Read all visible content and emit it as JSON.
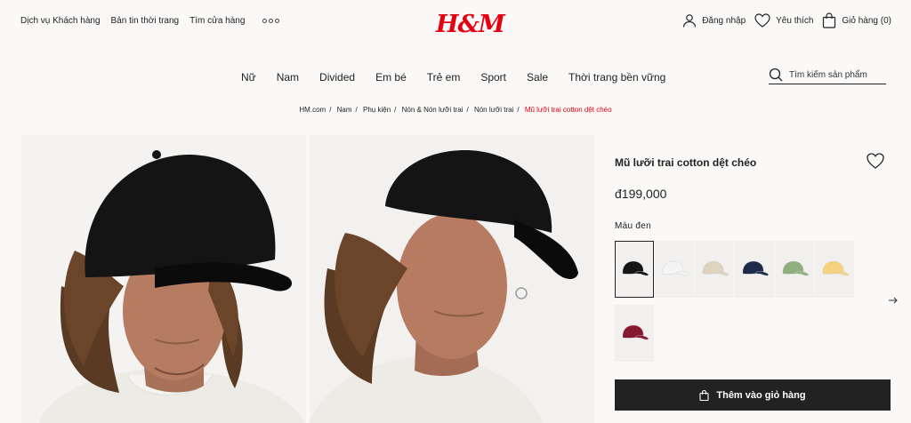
{
  "header": {
    "links": [
      "Dịch vụ Khách hàng",
      "Bản tin thời trang",
      "Tìm cửa hàng"
    ],
    "logo": "H&M",
    "account": {
      "login": "Đăng nhập",
      "favorites": "Yêu thích",
      "cart": "Giỏ hàng (0)"
    }
  },
  "nav": {
    "items": [
      "Nữ",
      "Nam",
      "Divided",
      "Em bé",
      "Trẻ em",
      "Sport",
      "Sale",
      "Thời trang bền vững"
    ],
    "search_placeholder": "Tìm kiếm sản phẩm"
  },
  "breadcrumb": {
    "items": [
      "HM.com",
      "Nam",
      "Phụ kiện",
      "Nón & Nón lưỡi trai",
      "Nón lưỡi trai"
    ],
    "current": "Mũ lưỡi trai cotton dệt chéo"
  },
  "product": {
    "title": "Mũ lưỡi trai cotton dệt chéo",
    "price": "đ199,000",
    "color_label": "Màu đen",
    "swatches": [
      {
        "color": "#151515",
        "selected": true
      },
      {
        "color": "#f4f4f4",
        "selected": false
      },
      {
        "color": "#ddd3bf",
        "selected": false
      },
      {
        "color": "#1e2a4a",
        "selected": false
      },
      {
        "color": "#8fb07e",
        "selected": false
      },
      {
        "color": "#f4d27f",
        "selected": false
      },
      {
        "color": "#8a1730",
        "selected": false
      }
    ],
    "add_to_cart": "Thêm vào giỏ hàng"
  },
  "colors": {
    "brand": "#e50010",
    "button_bg": "#222222"
  }
}
